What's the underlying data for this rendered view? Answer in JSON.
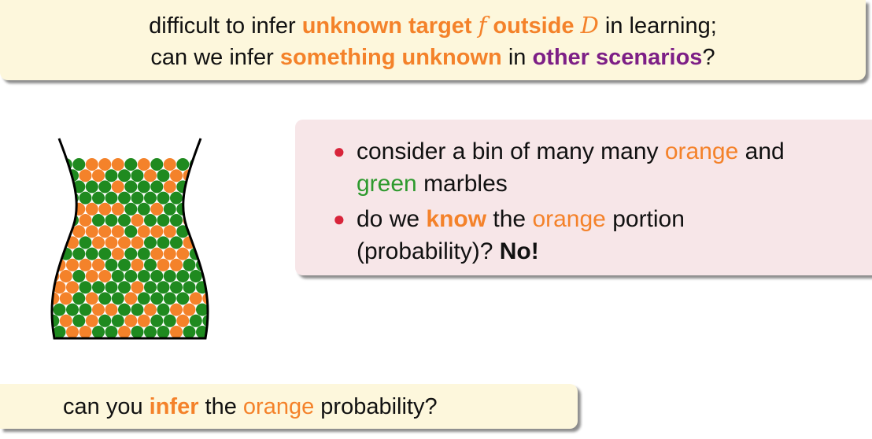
{
  "top": {
    "line1": {
      "t1": "difficult to infer ",
      "t2": "unknown target ",
      "t3": "f",
      "t4": " outside ",
      "t5": "D",
      "t6": " in learning;"
    },
    "line2": {
      "t1": "can we infer ",
      "t2": "something unknown",
      "t3": " in ",
      "t4": "other scenarios",
      "t5": "?"
    }
  },
  "bullets": {
    "b1": {
      "t1": "consider a bin of many many ",
      "t2": "orange",
      "t3": " and",
      "t4": "green",
      "t5": " marbles"
    },
    "b2": {
      "t1": "do we ",
      "t2": "know",
      "t3": " the ",
      "t4": "orange",
      "t5": " portion",
      "t6": "(probability)? ",
      "t7": "No!"
    }
  },
  "bottom": {
    "t1": "can you ",
    "t2": "infer",
    "t3": " the ",
    "t4": "orange",
    "t5": " probability?"
  },
  "colors": {
    "orange": "#f4822a",
    "green": "#1f8a1f",
    "purple": "#7d1f86",
    "bullet": "#d8243a",
    "yellow_box": "#fdf7dc",
    "pink_box": "#f7e6e8"
  },
  "bin": {
    "icon": "marble-bin-icon",
    "orange_fraction": 0.4
  }
}
